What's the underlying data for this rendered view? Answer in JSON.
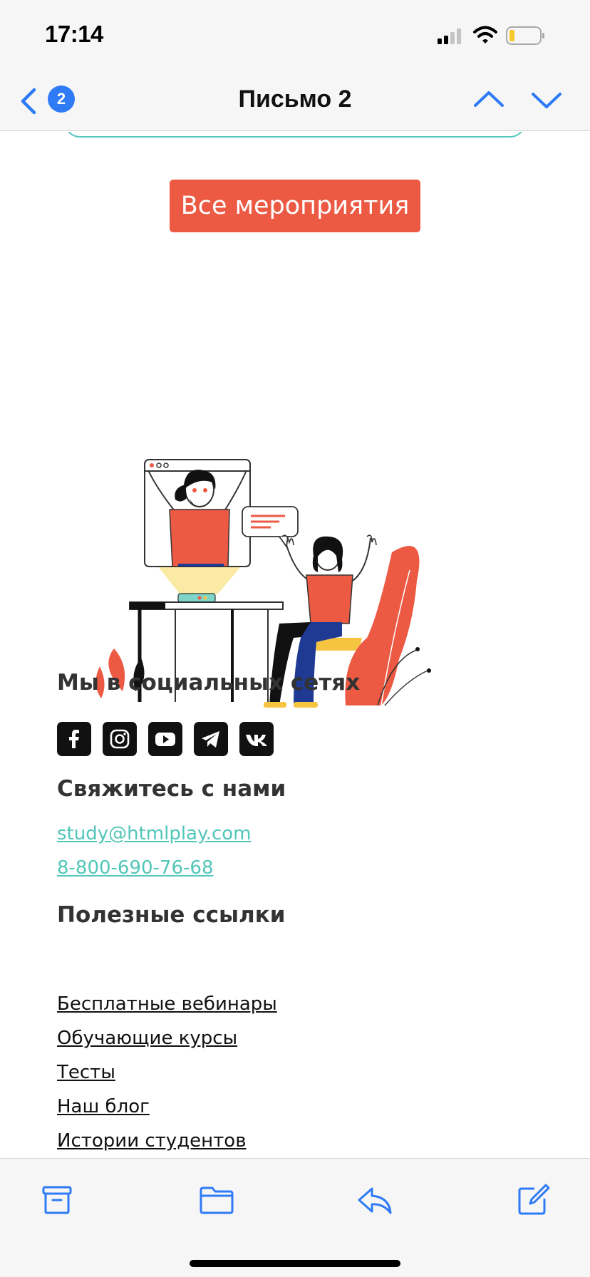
{
  "status_bar": {
    "time": "17:14",
    "icons": [
      "cellular-signal-icon",
      "wifi-icon",
      "battery-icon"
    ]
  },
  "nav": {
    "title": "Письмо 2",
    "unread_count": "2",
    "icons": [
      "back-chevron-icon",
      "previous-message-icon",
      "next-message-icon"
    ],
    "accent_color": "#2f7bf5"
  },
  "main": {
    "events_button_label": "Все мероприятия",
    "button_color": "#ec5a44",
    "illustration": "online-webinar-illustration"
  },
  "social": {
    "heading": "Мы в социальных сетях",
    "networks": [
      "facebook-icon",
      "instagram-icon",
      "youtube-icon",
      "telegram-icon",
      "vk-icon"
    ]
  },
  "contacts": {
    "heading": "Свяжитесь с нами",
    "email": "study@htmlplay.com",
    "phone": "8-800-690-76-68",
    "link_color": "#52c6b9"
  },
  "useful_links": {
    "heading": "Полезные ссылки",
    "items": [
      "Бесплатные вебинары",
      "Обучающие курсы",
      "Тесты",
      "Наш блог",
      "Истории студентов"
    ]
  },
  "toolbar": {
    "icons": [
      "archive-icon",
      "move-to-folder-icon",
      "reply-icon",
      "compose-icon"
    ]
  }
}
